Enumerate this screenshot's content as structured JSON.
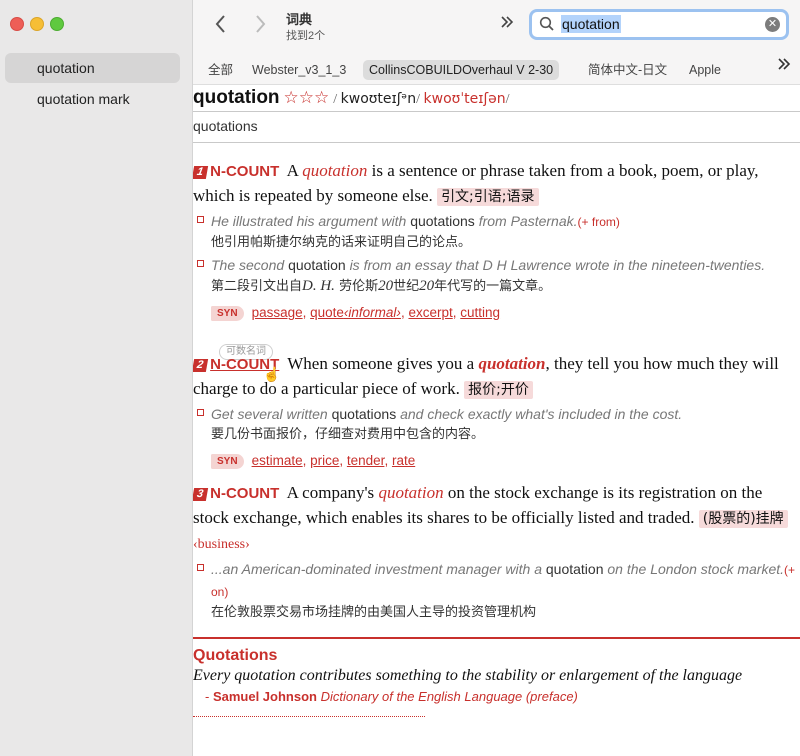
{
  "sidebar": {
    "items": [
      {
        "label": "quotation",
        "selected": true
      },
      {
        "label": "quotation mark",
        "selected": false
      }
    ]
  },
  "toolbar": {
    "back_icon": "chevron-left-icon",
    "forward_icon": "chevron-right-icon",
    "title": "词典",
    "subtitle": "找到2个",
    "more_icon": "double-chevron-right-icon"
  },
  "search": {
    "value": "quotation",
    "icon": "search-icon",
    "clear_icon": "clear-icon"
  },
  "tabs": [
    {
      "label": "全部"
    },
    {
      "label": "Webster_v3_1_3"
    },
    {
      "label": "CollinsCOBUILDOverhaul V 2-30",
      "active": true
    },
    {
      "label": "简体中文-日文"
    },
    {
      "label": "Apple"
    }
  ],
  "entry": {
    "headword": "quotation",
    "stars": "☆☆☆",
    "pron_uk": "kwoʊteɪʃᵊn",
    "pron_us": "kwoʊˈteɪʃən",
    "inflection": "quotations",
    "senses": [
      {
        "num": "1",
        "pos": "N-COUNT",
        "def_before": "A",
        "keyword": "quotation",
        "def_after": "is a sentence or phrase taken from a book, poem, or play, which is repeated by someone else.",
        "zh": "引文;引语;语录",
        "examples": [
          {
            "text_a": "He illustrated his argument with",
            "text_norm": "quotations",
            "text_b": "from Pasternak.",
            "tag": "(+ from)",
            "zh": "他引用帕斯捷尔纳克的话来证明自己的论点。"
          },
          {
            "text_a": "The second",
            "text_norm": "quotation",
            "text_b": "is from an essay that D H Lawrence wrote in the nineteen-twenties.",
            "zh_a": "第二段引文出自",
            "zh_i1": "D. H.",
            "zh_b": " 劳伦斯",
            "zh_i2": "20",
            "zh_c": "世纪",
            "zh_i3": "20",
            "zh_d": "年代写的一篇文章。"
          }
        ],
        "syn_label": "SYN",
        "syns": [
          "passage",
          "quote",
          "excerpt",
          "cutting"
        ],
        "syn_quote_note": "‹informal›"
      },
      {
        "num": "2",
        "pos": "N-COUNT",
        "tooltip": "可数名词",
        "def_before": "When someone gives you a",
        "keyword": "quotation",
        "def_after": ", they tell you how much they will charge to do a particular piece of work.",
        "zh": "报价;开价",
        "examples": [
          {
            "text_a": "Get several written",
            "text_norm": "quotations",
            "text_b": "and check exactly what's included in the cost.",
            "zh": "要几份书面报价，仔细查对费用中包含的内容。"
          }
        ],
        "syn_label": "SYN",
        "syns": [
          "estimate",
          "price",
          "tender",
          "rate"
        ]
      },
      {
        "num": "3",
        "pos": "N-COUNT",
        "def_before": "A company's",
        "keyword": "quotation",
        "def_after": "on the stock exchange is its registration on the stock exchange, which enables its shares to be officially listed and traded.",
        "zh": "(股票的)挂牌",
        "register": "‹business›",
        "examples": [
          {
            "text_a": "...an American-dominated investment manager with a",
            "text_norm": "quotation",
            "text_b": "on the London stock market.",
            "tag": "(+ on)",
            "zh": "在伦敦股票交易市场挂牌的由美国人主导的投资管理机构"
          }
        ]
      }
    ],
    "quotations": {
      "title": "Quotations",
      "text": "Every quotation contributes something to the stability or enlargement of the language",
      "dash": "- ",
      "author": "Samuel Johnson",
      "work": "Dictionary of the English Language (preface)"
    }
  },
  "colors": {
    "accent_red": "#c8302c",
    "sidebar_bg": "#e9e8e8",
    "selection": "#b3d3fb"
  }
}
